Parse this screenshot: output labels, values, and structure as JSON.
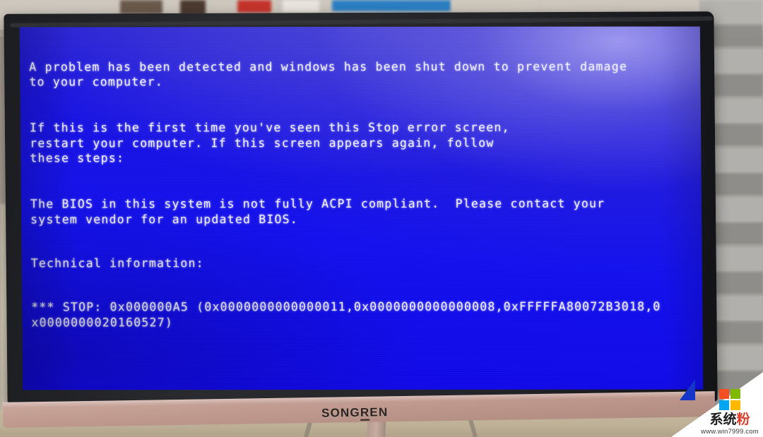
{
  "photo": {
    "subject": "photograph of a monitor displaying a Windows blue screen of death",
    "monitor_brand": "SONGREN"
  },
  "bsod": {
    "paragraphs": [
      "A problem has been detected and windows has been shut down to prevent damage\nto your computer.",
      "If this is the first time you've seen this Stop error screen,\nrestart your computer. If this screen appears again, follow\nthese steps:",
      "The BIOS in this system is not fully ACPI compliant.  Please contact your\nsystem vendor for an updated BIOS.",
      "Technical information:",
      "*** STOP: 0x000000A5 (0x0000000000000011,0x0000000000000008,0xFFFFFA80072B3018,0\nx0000000020160527)"
    ],
    "stop_code": "0x000000A5",
    "parameters": [
      "0x0000000000000011",
      "0x0000000000000008",
      "0xFFFFFA80072B3018",
      "0x0000000020160527"
    ],
    "background_color": "#1310EF",
    "text_color": "#F2F2FF"
  },
  "watermark": {
    "site_name_cn": "系统粉",
    "site_name_part1": "系统",
    "site_name_part2": "粉",
    "url": "www.win7999.com",
    "logo_colors": [
      "#f25022",
      "#7fba00",
      "#00a4ef",
      "#ffb900"
    ]
  }
}
